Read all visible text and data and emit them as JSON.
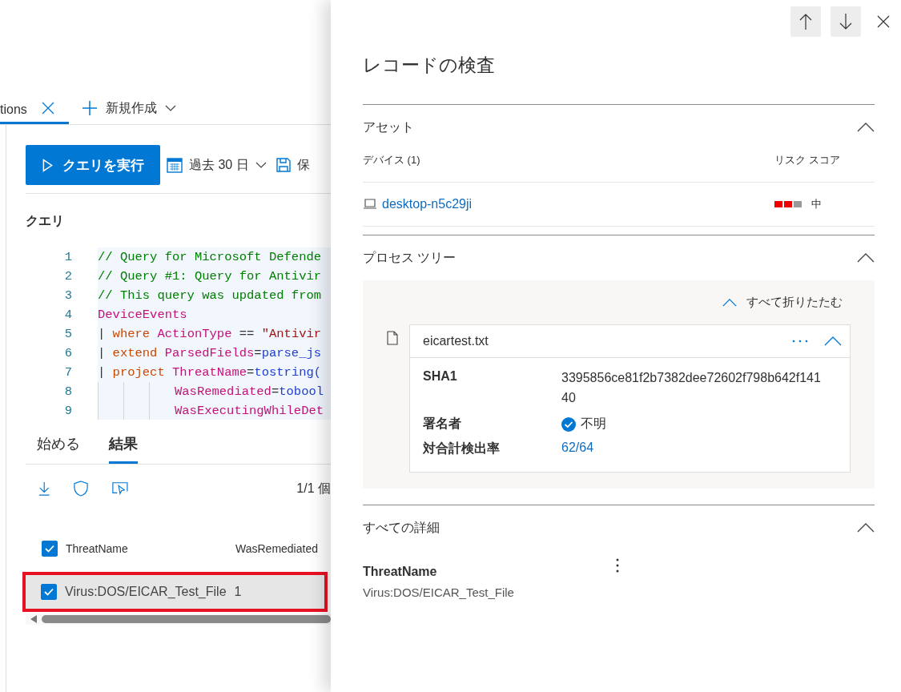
{
  "query_tabs": [
    {
      "label": "tions",
      "selected": true
    }
  ],
  "new_button": {
    "label": "新規作成"
  },
  "toolbar": {
    "run_button": "クエリを実行",
    "time_range": "過去 30 日",
    "save_button": "保"
  },
  "editor": {
    "heading": "クエリ",
    "lines": [
      {
        "number": "1",
        "kind": "plain",
        "tokens": [
          {
            "text": "// Query for Microsoft Defende",
            "kind": "comment"
          }
        ]
      },
      {
        "number": "2",
        "kind": "plain",
        "tokens": [
          {
            "text": "// Query #1: Query for Antivir",
            "kind": "comment"
          }
        ]
      },
      {
        "number": "3",
        "kind": "plain",
        "tokens": [
          {
            "text": "// This query was updated from",
            "kind": "comment"
          }
        ]
      },
      {
        "number": "4",
        "kind": "plain",
        "tokens": [
          {
            "text": "DeviceEvents",
            "kind": "table"
          }
        ]
      },
      {
        "number": "5",
        "kind": "plain",
        "tokens": [
          {
            "text": "| ",
            "kind": "operator"
          },
          {
            "text": "where",
            "kind": "keyword"
          },
          {
            "text": " ActionType",
            "kind": "column"
          },
          {
            "text": " == ",
            "kind": "operator"
          },
          {
            "text": "\"Antivir",
            "kind": "string"
          }
        ]
      },
      {
        "number": "6",
        "kind": "plain",
        "tokens": [
          {
            "text": "| ",
            "kind": "operator"
          },
          {
            "text": "extend",
            "kind": "keyword"
          },
          {
            "text": " ParsedFields",
            "kind": "column"
          },
          {
            "text": "=",
            "kind": "operator"
          },
          {
            "text": "parse_js",
            "kind": "function"
          }
        ]
      },
      {
        "number": "7",
        "kind": "plain",
        "tokens": [
          {
            "text": "| ",
            "kind": "operator"
          },
          {
            "text": "project",
            "kind": "keyword"
          },
          {
            "text": " ThreatName",
            "kind": "column"
          },
          {
            "text": "=",
            "kind": "operator"
          },
          {
            "text": "tostring(",
            "kind": "function"
          }
        ]
      },
      {
        "number": "8",
        "kind": "continued",
        "tokens": [
          {
            "text": "WasRemediated",
            "kind": "column"
          },
          {
            "text": "=",
            "kind": "operator"
          },
          {
            "text": "tobool",
            "kind": "function"
          }
        ]
      },
      {
        "number": "9",
        "kind": "continued",
        "tokens": [
          {
            "text": "WasExecutingWhileDet",
            "kind": "column"
          }
        ]
      }
    ]
  },
  "result_tabs": [
    {
      "label": "始める",
      "selected": false
    },
    {
      "label": "結果",
      "selected": true
    }
  ],
  "results": {
    "count": "1/1 個",
    "all_checked": true,
    "columns": [
      "ThreatName",
      "WasRemediated"
    ],
    "rows": [
      {
        "checked": true,
        "highlighted": true,
        "cells": [
          "Virus:DOS/EICAR_Test_File",
          "1"
        ]
      }
    ]
  },
  "drawer": {
    "title": "レコードの検査",
    "asset_section": {
      "title": "アセット",
      "expanded": true,
      "device_header": "デバイス (1)",
      "risk_header": "リスク スコア",
      "device": "desktop-n5c29ji",
      "risk_meter": {
        "level": 0.67
      },
      "risk_label": "中"
    },
    "process_section": {
      "title": "プロセス ツリー",
      "expanded": true,
      "collapse_all": "すべて折りたたむ",
      "node": {
        "name": "eicartest.txt",
        "expanded": true,
        "fields": [
          {
            "label": "SHA1",
            "value": "3395856ce81f2b7382dee72602f798b642f14140",
            "kind": "text"
          },
          {
            "label": "署名者",
            "value": "不明",
            "kind": "verified"
          },
          {
            "label": "対合計検出率",
            "value": "62/64",
            "kind": "link"
          }
        ]
      }
    },
    "details_section": {
      "title": "すべての詳細",
      "expanded": true,
      "fields": [
        {
          "label": "ThreatName",
          "value": "Virus:DOS/EICAR_Test_File"
        }
      ]
    }
  }
}
